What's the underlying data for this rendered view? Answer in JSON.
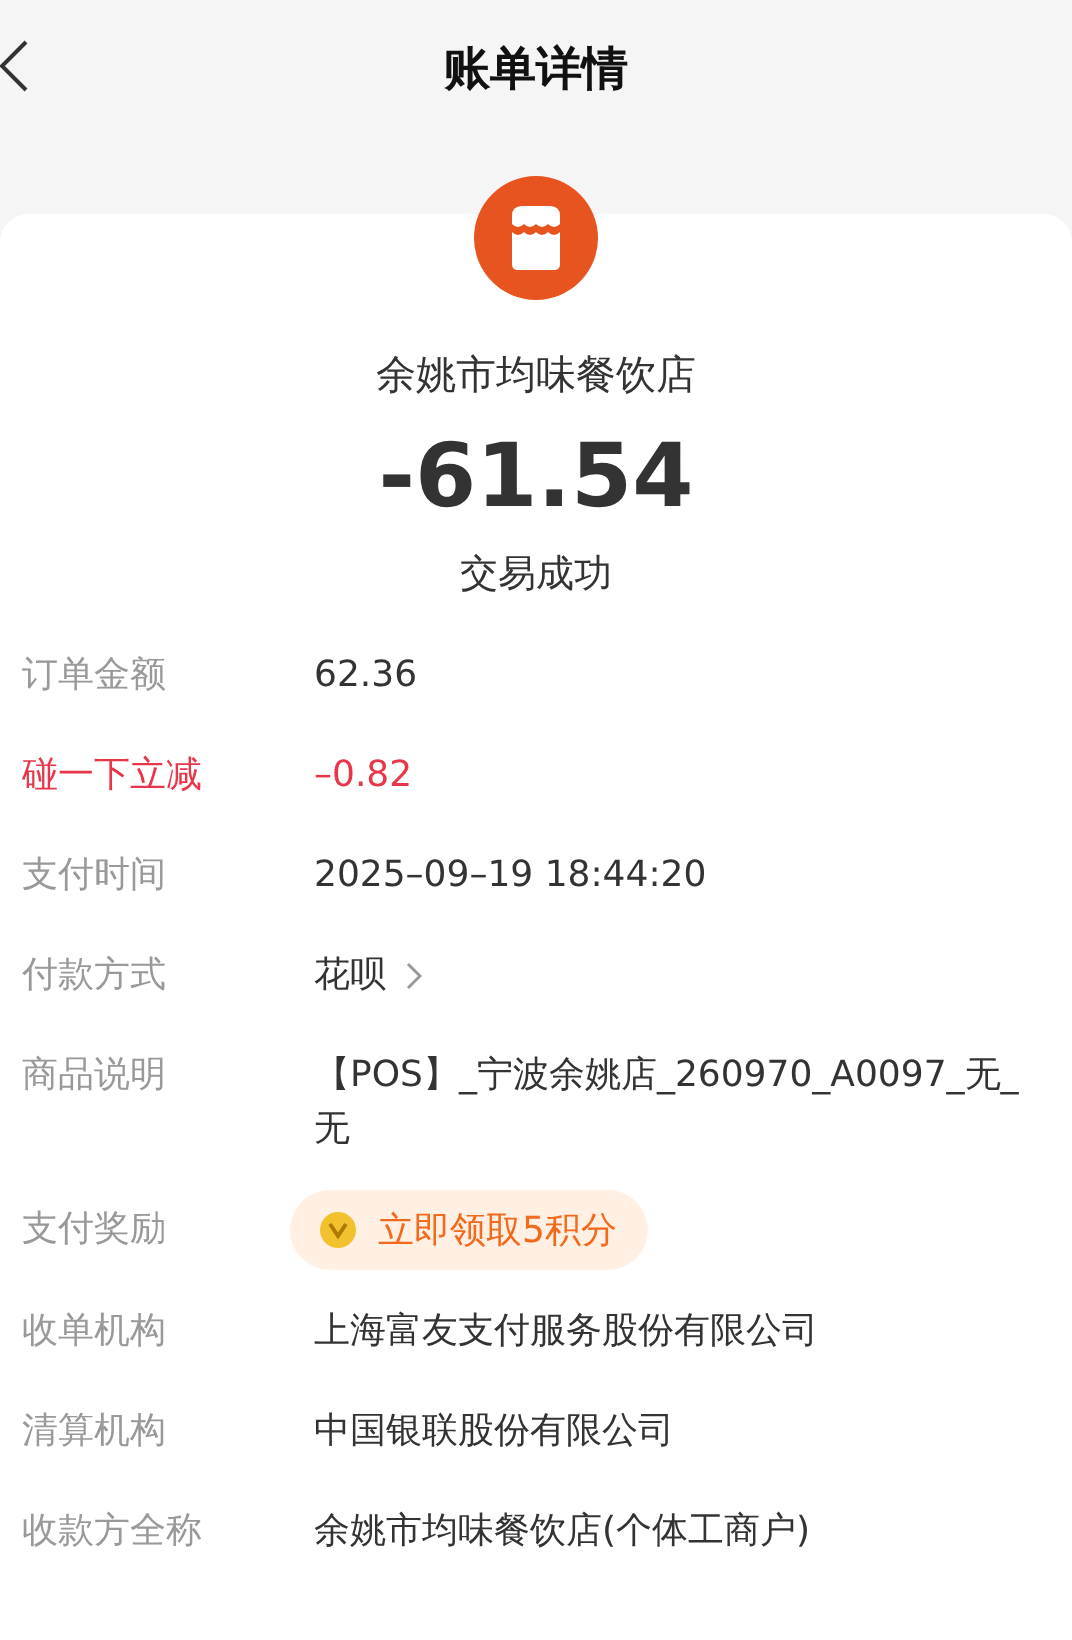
{
  "header": {
    "title": "账单详情"
  },
  "summary": {
    "merchant": "余姚市均味餐饮店",
    "amount": "-61.54",
    "status": "交易成功"
  },
  "rows": [
    {
      "kind": "plain",
      "label": "订单金额",
      "value": "62.36"
    },
    {
      "kind": "discount",
      "label": "碰一下立减",
      "value": "–0.82"
    },
    {
      "kind": "plain",
      "label": "支付时间",
      "value": "2025–09–19 18:44:20"
    },
    {
      "kind": "link",
      "label": "付款方式",
      "value": "花呗"
    },
    {
      "kind": "plain",
      "label": "商品说明",
      "value": "【POS】_宁波余姚店_260970_A0097_无_无"
    },
    {
      "kind": "reward",
      "label": "支付奖励",
      "value": "立即领取5积分"
    },
    {
      "kind": "plain",
      "label": "收单机构",
      "value": "上海富友支付服务股份有限公司"
    },
    {
      "kind": "plain",
      "label": "清算机构",
      "value": "中国银联股份有限公司"
    },
    {
      "kind": "plain",
      "label": "收款方全称",
      "value": "余姚市均味餐饮店(个体工商户)"
    }
  ]
}
